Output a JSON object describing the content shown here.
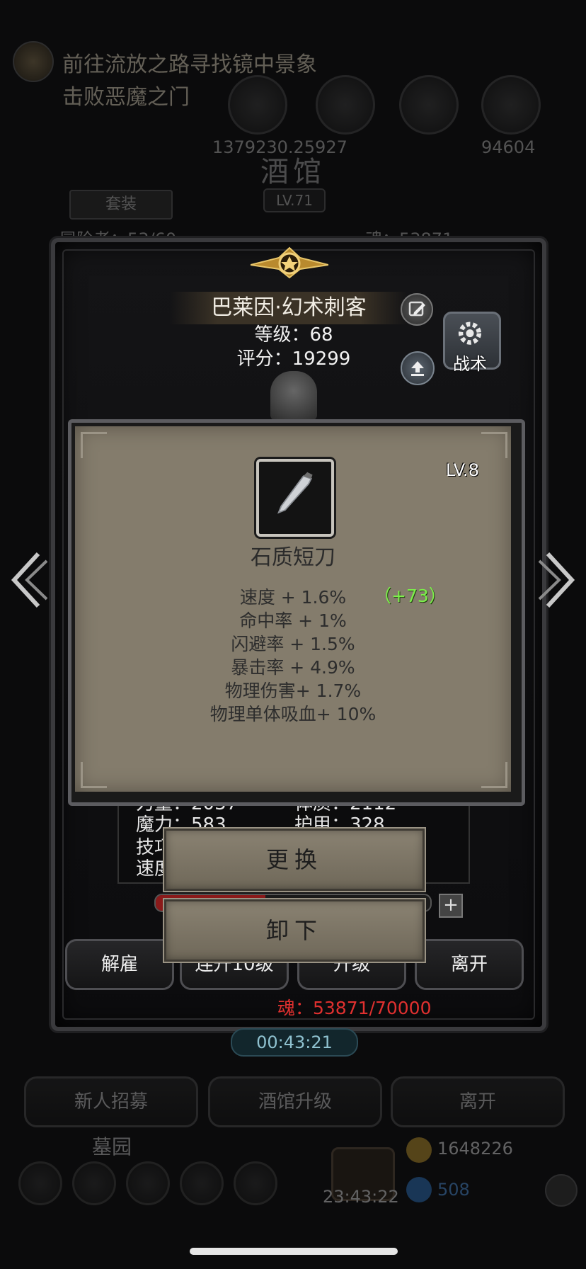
{
  "quest": {
    "line1": "前往流放之路寻找镜中景象",
    "line2": "击败恶魔之门"
  },
  "top_resources": {
    "value_left": "1379230.25927",
    "value_right": "94604"
  },
  "tavern": {
    "title": "酒馆",
    "level": "LV.71",
    "suit_button": "套装",
    "capacity": "冒险者：53/60",
    "soul": "魂：53871"
  },
  "hero": {
    "name": "巴莱因·幻术刺客",
    "level_line": "等级：68",
    "score_line": "评分：19299",
    "tactic_label": "战术"
  },
  "attributes": {
    "strength": "力量：2037",
    "constitution": "体质：2112",
    "magic": "魔力：583",
    "armor": "护甲：328",
    "skill": "技巧",
    "speed": "速度"
  },
  "equipment": {
    "level": "LV.8",
    "name": "石质短刀",
    "icon": "dagger-icon",
    "stats": [
      "速度 + 1.6%",
      "命中率 + 1%",
      "闪避率 + 1.5%",
      "暴击率 + 4.9%",
      "物理伤害+ 1.7%",
      "物理单体吸血+ 10%"
    ],
    "speed_bonus": "（+73）",
    "bonus_color": "#7cf04a",
    "replace_button": "更换",
    "unequip_button": "卸下"
  },
  "actions": {
    "dismiss": "解雇",
    "upgrade10": "连升10级",
    "upgrade": "升级",
    "leave": "离开",
    "soul_progress": "魂：53871/70000",
    "exp_fill": 0.4,
    "timer": "00:43:21"
  },
  "bottom": {
    "recruit": "新人招募",
    "tavern_upgrade": "酒馆升级",
    "leave": "离开",
    "cemetery": "墓园",
    "timer": "23:43:22",
    "gold": "1648226",
    "gems": "508"
  }
}
